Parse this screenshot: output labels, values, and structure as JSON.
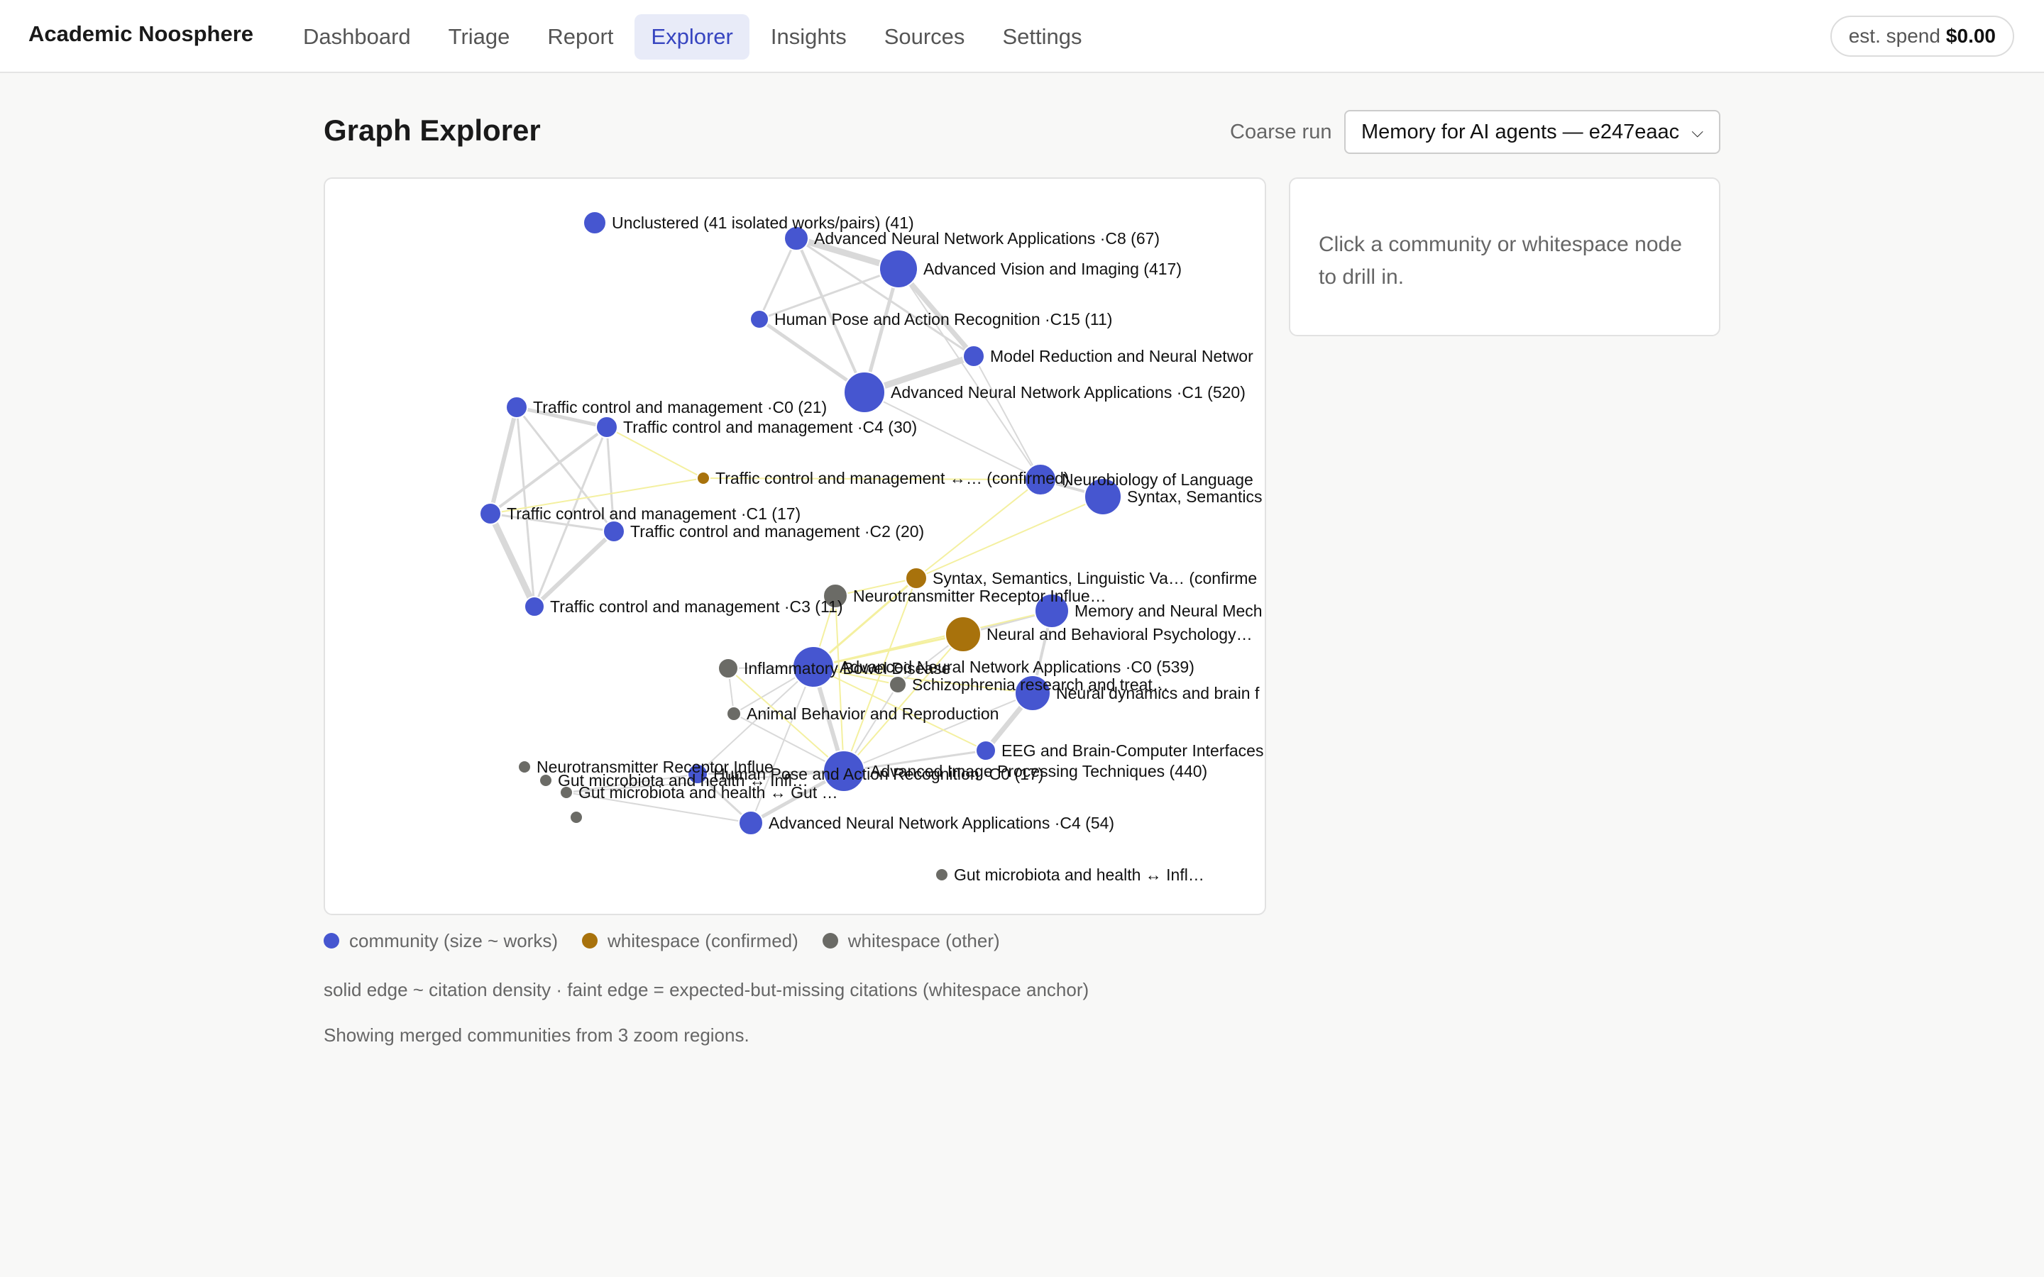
{
  "app": {
    "brand": "Academic Noosphere",
    "nav": [
      {
        "label": "Dashboard",
        "active": false
      },
      {
        "label": "Triage",
        "active": false
      },
      {
        "label": "Report",
        "active": false
      },
      {
        "label": "Explorer",
        "active": true
      },
      {
        "label": "Insights",
        "active": false
      },
      {
        "label": "Sources",
        "active": false
      },
      {
        "label": "Settings",
        "active": false
      }
    ],
    "spend_label": "est. spend",
    "spend_value": "$0.00"
  },
  "page": {
    "title": "Graph Explorer",
    "run_label": "Coarse run",
    "run_selected": "Memory for AI agents — e247eaac"
  },
  "side": {
    "hint": "Click a community or whitespace node to drill in."
  },
  "legend": {
    "community": "community (size ~ works)",
    "ws_confirmed": "whitespace (confirmed)",
    "ws_other": "whitespace (other)"
  },
  "notes": {
    "edges": "solid edge ~ citation density · faint edge = expected-but-missing citations (whitespace anchor)",
    "merged": "Showing merged communities from 3 zoom regions."
  },
  "colors": {
    "community": "#4656d0",
    "ws_confirmed": "#a8720c",
    "ws_other": "#6b6b66",
    "edge_solid": "#d9d9d9",
    "edge_faint": "#f4f0a0",
    "accent": "#3745c0"
  },
  "graph": {
    "nodes": [
      {
        "id": "unc",
        "type": "community",
        "label": "Unclustered (41 isolated works/pairs) (41)"
      },
      {
        "id": "ann-c8",
        "type": "community",
        "label": "Advanced Neural Network Applications ·C8 (67)"
      },
      {
        "id": "avi",
        "type": "community",
        "label": "Advanced Vision and Imaging (417)"
      },
      {
        "id": "hpar-c15",
        "type": "community",
        "label": "Human Pose and Action Recognition ·C15 (11)"
      },
      {
        "id": "mrnn",
        "type": "community",
        "label": "Model Reduction and Neural Networ"
      },
      {
        "id": "ann-c1",
        "type": "community",
        "label": "Advanced Neural Network Applications ·C1 (520)"
      },
      {
        "id": "tcm-c0",
        "type": "community",
        "label": "Traffic control and management ·C0 (21)"
      },
      {
        "id": "tcm-c4",
        "type": "community",
        "label": "Traffic control and management ·C4 (30)"
      },
      {
        "id": "ws-tcm",
        "type": "ws_confirmed",
        "label": "Traffic control and management ↔… (confirmed)"
      },
      {
        "id": "nol",
        "type": "community",
        "label": "Neurobiology of Language"
      },
      {
        "id": "ssl",
        "type": "community",
        "label": "Syntax, Semantics"
      },
      {
        "id": "tcm-c1",
        "type": "community",
        "label": "Traffic control and management ·C1 (17)"
      },
      {
        "id": "tcm-c2",
        "type": "community",
        "label": "Traffic control and management ·C2 (20)"
      },
      {
        "id": "ws-ssl",
        "type": "ws_confirmed",
        "label": "Syntax, Semantics, Linguistic Va… (confirme"
      },
      {
        "id": "ws-nri1",
        "type": "ws_other",
        "label": "Neurotransmitter Receptor Influe…"
      },
      {
        "id": "tcm-c3",
        "type": "community",
        "label": "Traffic control and management ·C3 (11)"
      },
      {
        "id": "mnm",
        "type": "community",
        "label": "Memory and Neural Mech"
      },
      {
        "id": "ws-nbp",
        "type": "ws_confirmed",
        "label": "Neural and Behavioral Psychology…"
      },
      {
        "id": "ws-ibd",
        "type": "ws_other",
        "label": "Inflammatory Bowel Disease"
      },
      {
        "id": "ann-c0",
        "type": "community",
        "label": "Advanced Neural Network Applications ·C0 (539)"
      },
      {
        "id": "ws-schz",
        "type": "ws_other",
        "label": "Schizophrenia research and treat…"
      },
      {
        "id": "ndbf",
        "type": "community",
        "label": "Neural dynamics and brain f"
      },
      {
        "id": "ws-abr",
        "type": "ws_other",
        "label": "Animal Behavior and Reproduction"
      },
      {
        "id": "eeg",
        "type": "community",
        "label": "EEG and Brain-Computer Interfaces"
      },
      {
        "id": "ws-nri2",
        "type": "ws_other",
        "label": "Neurotransmitter Receptor Influe"
      },
      {
        "id": "hpar-c0",
        "type": "community",
        "label": "Human Pose and Action Recognition ·C0 (17)"
      },
      {
        "id": "aipt",
        "type": "community",
        "label": "Advanced Image Processing Techniques (440)"
      },
      {
        "id": "ws-gut1",
        "type": "ws_other",
        "label": "Gut microbiota and health ↔ Infl…"
      },
      {
        "id": "ws-gut2",
        "type": "ws_other",
        "label": "Gut microbiota and health ↔ Gut …"
      },
      {
        "id": "ws-unl",
        "type": "ws_other",
        "label": ""
      },
      {
        "id": "ann-c4",
        "type": "community",
        "label": "Advanced Neural Network Applications ·C4 (54)"
      },
      {
        "id": "ws-gut3",
        "type": "ws_other",
        "label": "Gut microbiota and health ↔ Infl…"
      }
    ]
  }
}
